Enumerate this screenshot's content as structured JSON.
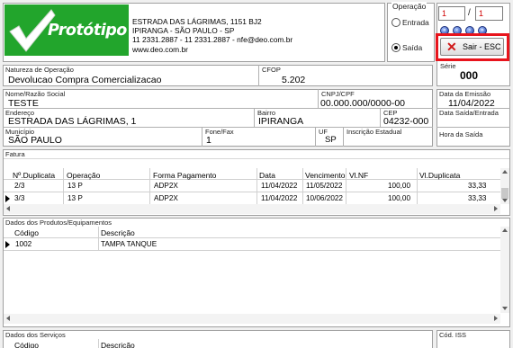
{
  "brand": {
    "logo_text": "Protótipo",
    "logo_color": "#22a52c"
  },
  "company": {
    "address": "ESTRADA DAS LÁGRIMAS, 1151 BJ2",
    "city": "IPIRANGA - SÃO PAULO - SP",
    "contact": "11 2331.2887 - 11 2331.2887 - nfe@deo.com.br",
    "website": "www.deo.com.br"
  },
  "operacao": {
    "label": "Operação",
    "entrada_label": "Entrada",
    "saida_label": "Saída",
    "selected": "saida"
  },
  "pager": {
    "current": "1",
    "separator": "/",
    "total": "1",
    "nav_icons": [
      "first-icon",
      "prev-icon",
      "next-icon",
      "last-icon"
    ]
  },
  "sair_button": {
    "label": "Sair - ESC",
    "highlight_color": "#e8141c"
  },
  "serie": {
    "label": "Série",
    "value": "000"
  },
  "natureza": {
    "label": "Natureza de Operação",
    "value": "Devolucao Compra Comercializacao"
  },
  "cfop": {
    "label": "CFOP",
    "value": "5.202"
  },
  "destinatario": {
    "nome_label": "Nome/Razão Social",
    "nome_value": "TESTE",
    "cnpj_label": "CNPJ/CPF",
    "cnpj_value": "00.000.000/0000-00",
    "emissao_label": "Data da Emissão",
    "emissao_value": "11/04/2022",
    "endereco_label": "Endereço",
    "endereco_value": "ESTRADA DAS LÁGRIMAS, 1",
    "bairro_label": "Bairro",
    "bairro_value": "IPIRANGA",
    "cep_label": "CEP",
    "cep_value": "04232-000",
    "saida_entrada_label": "Data Saída/Entrada",
    "municipio_label": "Município",
    "municipio_value": "SÃO PAULO",
    "fone_label": "Fone/Fax",
    "fone_value": "1",
    "uf_label": "UF",
    "uf_value": "SP",
    "ie_label": "Inscrição Estadual",
    "hora_label": "Hora da Saída"
  },
  "fatura": {
    "label": "Fatura",
    "columns": [
      "Nº.Duplicata",
      "Operação",
      "Forma Pagamento",
      "Data",
      "Vencimento",
      "Vl.NF",
      "Vl.Duplicata"
    ],
    "rows": [
      [
        "2/3",
        "13 P",
        "ADP2X",
        "11/04/2022",
        "11/05/2022",
        "100,00",
        "33,33"
      ],
      [
        "3/3",
        "13 P",
        "ADP2X",
        "11/04/2022",
        "10/06/2022",
        "100,00",
        "33,33"
      ]
    ]
  },
  "produtos": {
    "label": "Dados dos Produtos/Equipamentos",
    "columns": [
      "Código",
      "Descrição"
    ],
    "rows": [
      [
        "1002",
        "TAMPA TANQUE"
      ]
    ]
  },
  "servicos": {
    "label": "Dados dos Serviços",
    "cod_iss_label": "Cód. ISS",
    "columns": [
      "Código",
      "Descrição"
    ]
  }
}
